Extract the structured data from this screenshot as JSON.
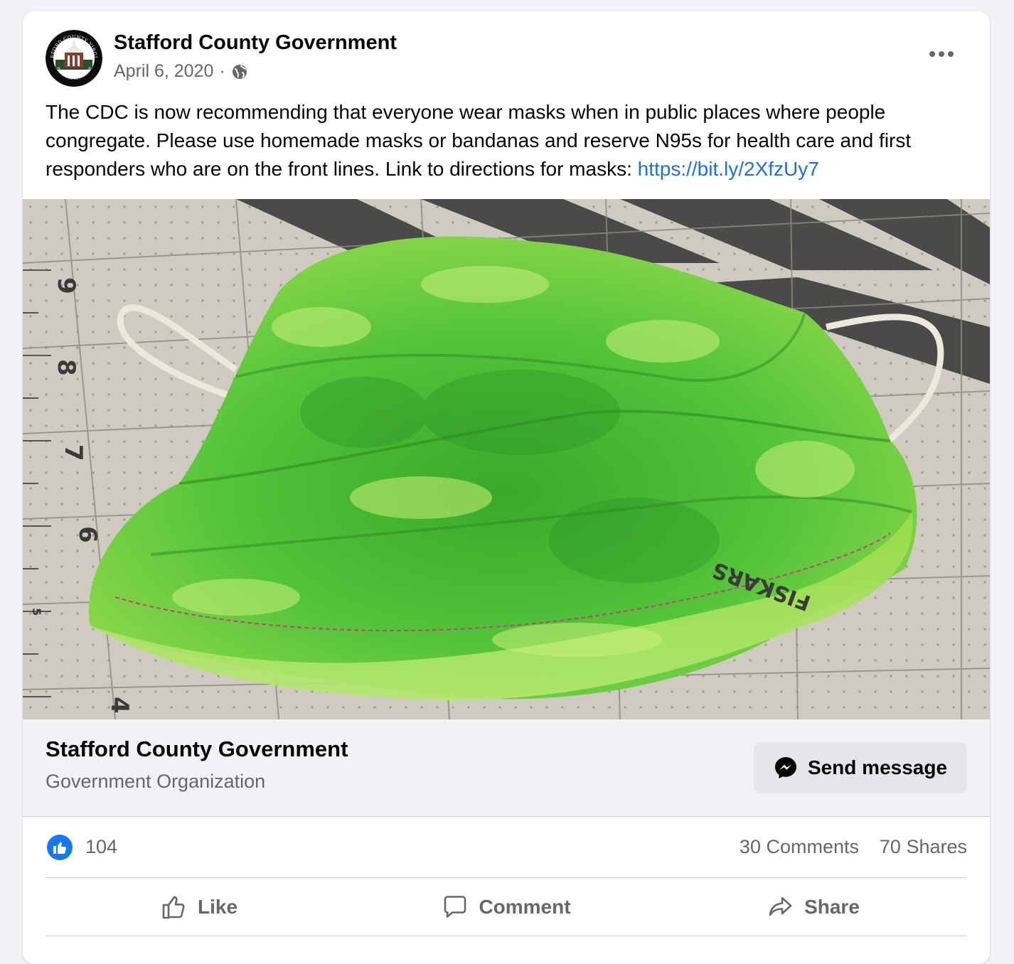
{
  "post": {
    "page_name": "Stafford County Government",
    "date": "April 6, 2020",
    "separator": "·",
    "text": "The CDC is now recommending that everyone wear masks when in public places where people congregate. Please use homemade masks or bandanas and reserve N95s for health care and first responders who are on the front lines. Link to directions for masks: ",
    "link": "https://bit.ly/2XfzUy7",
    "photo_alt": "Homemade green fabric face mask on a cutting mat"
  },
  "avatar": {
    "seal_text_top": "STAFFORD COUNTY VIRGINIA",
    "seal_text_bottom": "PROGRESS SINCE 1664"
  },
  "footer": {
    "page_name": "Stafford County Government",
    "category": "Government Organization",
    "send_message_label": "Send message"
  },
  "stats": {
    "likes": "104",
    "comments": "30 Comments",
    "shares": "70 Shares"
  },
  "actions": {
    "like": "Like",
    "comment": "Comment",
    "share": "Share"
  },
  "photo": {
    "ruler_numbers": [
      "9",
      "8",
      "7",
      "6",
      "5",
      "4"
    ],
    "brand_text": "FISKARS"
  },
  "colors": {
    "link": "#216fdb",
    "like_blue": "#1877f2",
    "secondary_text": "#65676b",
    "mask_green": "#3fbf2a"
  }
}
